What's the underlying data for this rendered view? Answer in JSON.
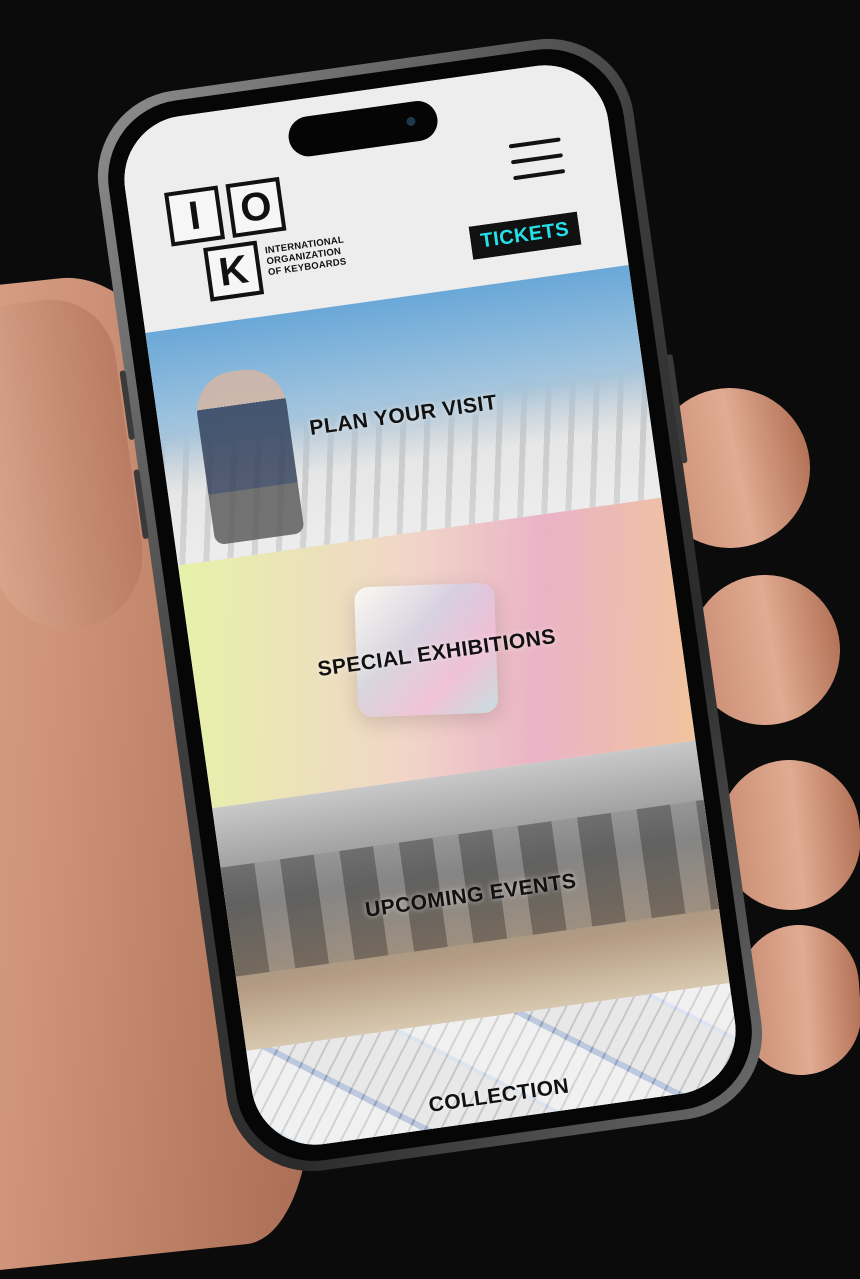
{
  "brand": {
    "logo_letters": [
      "I",
      "O",
      "K"
    ],
    "name_line1": "INTERNATIONAL",
    "name_line2": "ORGANIZATION",
    "name_line3": "OF KEYBOARDS"
  },
  "header": {
    "menu_icon": "hamburger-menu-icon",
    "tickets_label": "TICKETS",
    "tickets_color": "#25e0e8"
  },
  "sections": [
    {
      "label": "PLAN YOUR VISIT"
    },
    {
      "label": "SPECIAL EXHIBITIONS"
    },
    {
      "label": "UPCOMING EVENTS"
    },
    {
      "label": "COLLECTION"
    }
  ]
}
